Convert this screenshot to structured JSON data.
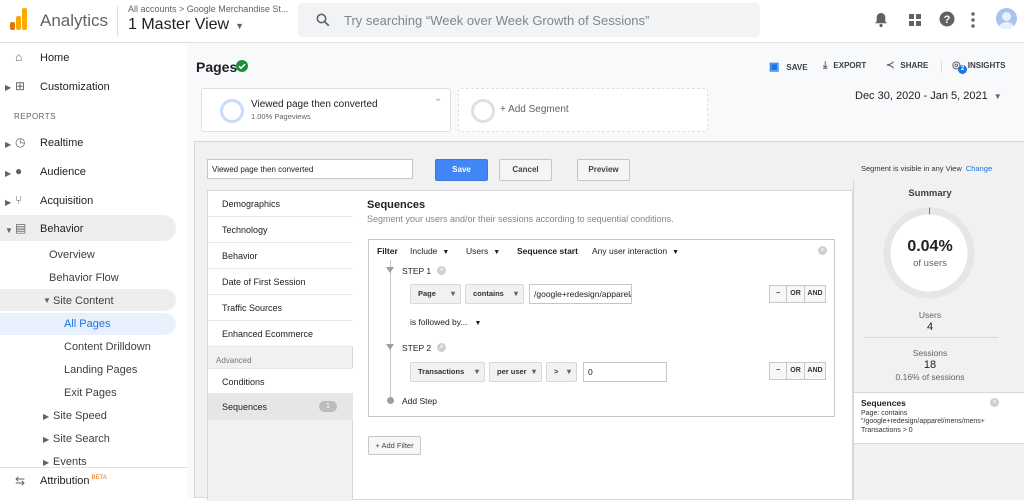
{
  "header": {
    "app_name": "Analytics",
    "breadcrumb": "All accounts > Google Merchandise St...",
    "view_name": "1 Master View",
    "search_placeholder": "Try searching “Week over Week Growth of Sessions”"
  },
  "sidebar": {
    "home": "Home",
    "customization": "Customization",
    "reports_heading": "REPORTS",
    "realtime": "Realtime",
    "audience": "Audience",
    "acquisition": "Acquisition",
    "behavior": "Behavior",
    "overview": "Overview",
    "behavior_flow": "Behavior Flow",
    "site_content": "Site Content",
    "all_pages": "All Pages",
    "content_drilldown": "Content Drilldown",
    "landing_pages": "Landing Pages",
    "exit_pages": "Exit Pages",
    "site_speed": "Site Speed",
    "site_search": "Site Search",
    "events": "Events",
    "attribution": "Attribution",
    "attribution_badge": "BETA"
  },
  "page": {
    "title": "Pages",
    "save": "SAVE",
    "export": "EXPORT",
    "share": "SHARE",
    "insights": "INSIGHTS",
    "insights_count": "2",
    "date_range": "Dec 30, 2020 - Jan 5, 2021"
  },
  "segments": {
    "active_name": "Viewed page then converted",
    "active_sub": "1.00% Pageviews",
    "add_segment": "+ Add Segment"
  },
  "editor": {
    "name_value": "Viewed page then converted",
    "save": "Save",
    "cancel": "Cancel",
    "preview": "Preview",
    "visibility": "Segment is visible in any View",
    "change": "Change",
    "menu": [
      "Demographics",
      "Technology",
      "Behavior",
      "Date of First Session",
      "Traffic Sources",
      "Enhanced Ecommerce"
    ],
    "advanced_label": "Advanced",
    "conditions": "Conditions",
    "sequences": "Sequences",
    "sequences_count": "1",
    "seq_title": "Sequences",
    "seq_desc": "Segment your users and/or their sessions according to sequential conditions.",
    "filter_label": "Filter",
    "include": "Include",
    "users": "Users",
    "sequence_start": "Sequence start",
    "any_interaction": "Any user interaction",
    "step1": "STEP 1",
    "step1_dim": "Page",
    "step1_op": "contains",
    "step1_value": "/google+redesign/apparel/mens/mens+",
    "followed_by": "is followed by...",
    "step2": "STEP 2",
    "step2_dim": "Transactions",
    "step2_scope": "per user",
    "step2_op": ">",
    "step2_value": "0",
    "minus": "−",
    "or": "OR",
    "and": "AND",
    "add_step": "Add Step",
    "add_filter": "+ Add Filter"
  },
  "summary": {
    "title": "Summary",
    "percent": "0.04%",
    "percent_label": "of users",
    "percent_fraction": 0.0004,
    "users_label": "Users",
    "users_value": "4",
    "sessions_label": "Sessions",
    "sessions_value": "18",
    "sessions_pct": "0.16% of sessions",
    "seq_title": "Sequences",
    "seq_line1": "Page: contains",
    "seq_line2": "\"/google+redesign/apparel/mens/mens+",
    "seq_line3": "Transactions > 0"
  },
  "colors": {
    "accent": "#4285f4",
    "selected_bg": "#e8f0fe",
    "selected_text": "#1a73e8",
    "verified": "#1e8e3e"
  }
}
